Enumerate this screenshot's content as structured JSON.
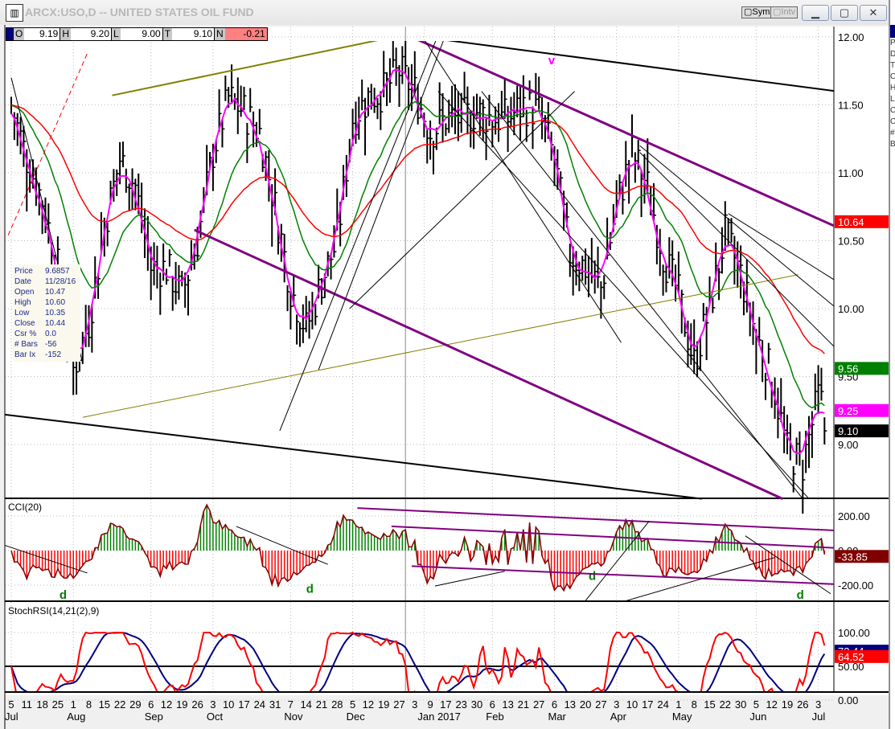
{
  "window": {
    "title": "ARCX:USO,D -- UNITED STATES OIL FUND",
    "app_icon": "chart-icon",
    "toolbar": {
      "sym_label": "Sym",
      "intv_label": "Intv"
    },
    "controls": {
      "minimize": "▁",
      "maximize": "▢",
      "close": "✕"
    }
  },
  "quote_bar": {
    "open_label": "O",
    "open": "9.19",
    "high_label": "H",
    "high": "9.20",
    "low_label": "L",
    "low": "9.00",
    "last_label": "T",
    "last": "9.10",
    "net_label": "N",
    "net": "-0.21"
  },
  "cursor_info": [
    {
      "k": "Price",
      "v": "9.6857"
    },
    {
      "k": "Date",
      "v": "11/28/16"
    },
    {
      "k": "Open",
      "v": "10.47"
    },
    {
      "k": "High",
      "v": "10.60"
    },
    {
      "k": "Low",
      "v": "10.35"
    },
    {
      "k": "Close",
      "v": "10.44"
    },
    {
      "k": "Csr %",
      "v": "0.0"
    },
    {
      "k": "# Bars",
      "v": "-56"
    },
    {
      "k": "Bar Ix",
      "v": "-152"
    }
  ],
  "right_panel_letters": [
    "P",
    "D",
    "T",
    "C",
    "H",
    "L",
    "C",
    "C",
    "#",
    "B"
  ],
  "colors": {
    "up": "#008000",
    "down": "#ff0000",
    "ma_fast": "#ff00ff",
    "ma_mid": "#008000",
    "ma_slow": "#ff0000",
    "purple": "#800080",
    "olive": "#808000",
    "stoch": "#ff0000",
    "stoch_signal": "#000080",
    "cci_line": "#800000"
  },
  "chart_data": {
    "type": "ohlc",
    "price_axis": {
      "ticks": [
        "12.00",
        "11.50",
        "11.00",
        "10.50",
        "10.00",
        "9.50",
        "9.00"
      ],
      "range": [
        8.6,
        12.1
      ]
    },
    "weekly_close_approx": [
      11.5,
      11.1,
      10.8,
      10.3,
      9.55,
      9.9,
      10.6,
      11.1,
      10.9,
      10.3,
      10.3,
      10.1,
      10.5,
      11.15,
      11.55,
      11.45,
      11.3,
      10.75,
      10.15,
      9.85,
      10.2,
      10.5,
      11.4,
      11.55,
      11.6,
      11.75,
      11.6,
      11.3,
      11.4,
      11.4,
      11.45,
      11.4,
      11.4,
      11.5,
      11.45,
      11.1,
      10.4,
      10.3,
      10.15,
      10.75,
      11.15,
      10.9,
      10.4,
      10.1,
      9.6,
      10.0,
      10.55,
      10.25,
      9.8,
      9.5,
      8.95,
      8.85,
      9.35,
      9.1
    ],
    "price_tags": [
      {
        "label": "10.64",
        "value": 10.64,
        "color": "#ff0000"
      },
      {
        "label": "9.56",
        "value": 9.56,
        "color": "#008000"
      },
      {
        "label": "9.25",
        "value": 9.25,
        "color": "#ff00ff"
      },
      {
        "label": "9.10",
        "value": 9.1,
        "color": "#000000"
      }
    ],
    "annotations": [
      {
        "text": "v",
        "week": 34.6,
        "price": 11.8,
        "color": "#ff00ff",
        "pane": "price"
      },
      {
        "text": "d",
        "week": 3.1,
        "cci": -280,
        "color": "#008000",
        "pane": "cci"
      },
      {
        "text": "d",
        "week": 19,
        "cci": -245,
        "color": "#008000",
        "pane": "cci"
      },
      {
        "text": "d",
        "week": 37.2,
        "cci": -170,
        "color": "#008000",
        "pane": "cci"
      },
      {
        "text": "d",
        "week": 50.6,
        "cci": -280,
        "color": "#008000",
        "pane": "cci"
      }
    ],
    "trendlines": [
      {
        "from": [
          19.8,
          12.1
        ],
        "to": [
          53.2,
          11.6
        ],
        "color": "#000000",
        "width": 2
      },
      {
        "from": [
          -0.4,
          9.22
        ],
        "to": [
          44.5,
          8.6
        ],
        "color": "#000000",
        "width": 2
      },
      {
        "from": [
          6.5,
          11.57
        ],
        "to": [
          28,
          12.08
        ],
        "color": "#808000",
        "width": 2
      },
      {
        "from": [
          4.6,
          9.2
        ],
        "to": [
          50.7,
          10.25
        ],
        "color": "#808000",
        "width": 1
      },
      {
        "from": [
          25.8,
          12.0
        ],
        "to": [
          53.2,
          10.6
        ],
        "color": "#800080",
        "width": 3
      },
      {
        "from": [
          11.8,
          10.58
        ],
        "to": [
          49.7,
          8.6
        ],
        "color": "#800080",
        "width": 3
      },
      {
        "from": [
          -0.2,
          10.54
        ],
        "to": [
          4.9,
          11.88
        ],
        "color": "#ff0000",
        "width": 1,
        "dash": true
      },
      {
        "from": [
          0,
          11.7
        ],
        "to": [
          4.6,
          9.6
        ],
        "color": "#000000",
        "width": 1
      },
      {
        "from": [
          17.3,
          9.1
        ],
        "to": [
          27.8,
          12.1
        ],
        "color": "#000000",
        "width": 1
      },
      {
        "from": [
          19.8,
          9.55
        ],
        "to": [
          28.2,
          12.08
        ],
        "color": "#000000",
        "width": 1
      },
      {
        "from": [
          21.8,
          10.0
        ],
        "to": [
          36.3,
          11.6
        ],
        "color": "#000000",
        "width": 1
      },
      {
        "from": [
          26.5,
          12.0
        ],
        "to": [
          39.3,
          9.75
        ],
        "color": "#000000",
        "width": 1
      },
      {
        "from": [
          27.5,
          11.6
        ],
        "to": [
          51.4,
          8.6
        ],
        "color": "#000000",
        "width": 1
      },
      {
        "from": [
          30.3,
          11.6
        ],
        "to": [
          51,
          8.6
        ],
        "color": "#000000",
        "width": 1
      },
      {
        "from": [
          40.5,
          11.2
        ],
        "to": [
          53.2,
          10.0
        ],
        "color": "#000000",
        "width": 1
      },
      {
        "from": [
          40.5,
          11.15
        ],
        "to": [
          53.2,
          9.7
        ],
        "color": "#000000",
        "width": 1
      },
      {
        "from": [
          46.2,
          10.7
        ],
        "to": [
          53.2,
          10.2
        ],
        "color": "#000000",
        "width": 1
      }
    ],
    "cci": {
      "title": "CCI(20)",
      "ticks": [
        "200.00",
        "0.00",
        "-200.00"
      ],
      "last_label": "-33.85",
      "trendlines": [
        {
          "from": [
            22.3,
            246
          ],
          "to": [
            53.2,
            116
          ],
          "color": "#800080",
          "width": 2
        },
        {
          "from": [
            24.5,
            140
          ],
          "to": [
            53.2,
            15
          ],
          "color": "#800080",
          "width": 2
        },
        {
          "from": [
            25.8,
            -90
          ],
          "to": [
            53.2,
            -195
          ],
          "color": "#800080",
          "width": 2
        },
        {
          "from": [
            27.3,
            -205
          ],
          "to": [
            31.8,
            -120
          ],
          "color": "#000000",
          "width": 1
        },
        {
          "from": [
            36.2,
            -380
          ],
          "to": [
            41.1,
            170
          ],
          "color": "#000000",
          "width": 1
        },
        {
          "from": [
            36.2,
            -380
          ],
          "to": [
            49.2,
            -40
          ],
          "color": "#000000",
          "width": 1
        },
        {
          "from": [
            -0.4,
            30
          ],
          "to": [
            4.9,
            -130
          ],
          "color": "#000000",
          "width": 1
        },
        {
          "from": [
            14.5,
            140
          ],
          "to": [
            20.4,
            -80
          ],
          "color": "#000000",
          "width": 1
        },
        {
          "from": [
            47.3,
            85
          ],
          "to": [
            52.8,
            -250
          ],
          "color": "#000000",
          "width": 1
        }
      ]
    },
    "stochrsi": {
      "title": "StochRSI(14,21(2),9)",
      "ticks": [
        "100.00",
        "50.00",
        "0.00"
      ],
      "blue_label": "72.44",
      "red_label": "64.52",
      "level": 50
    },
    "date_axis": {
      "days": [
        "5",
        "11",
        "18",
        "25",
        "1",
        "8",
        "15",
        "22",
        "29",
        "6",
        "12",
        "19",
        "26",
        "3",
        "10",
        "17",
        "24",
        "31",
        "7",
        "14",
        "21",
        "28",
        "5",
        "12",
        "19",
        "27",
        "3",
        "9",
        "17",
        "23",
        "30",
        "6",
        "13",
        "21",
        "27",
        "6",
        "13",
        "20",
        "27",
        "3",
        "10",
        "17",
        "24",
        "1",
        "8",
        "15",
        "22",
        "30",
        "5",
        "12",
        "19",
        "26",
        "3"
      ],
      "months": [
        {
          "label": "Jul",
          "week": 0
        },
        {
          "label": "Aug",
          "week": 4
        },
        {
          "label": "Sep",
          "week": 9
        },
        {
          "label": "Oct",
          "week": 13
        },
        {
          "label": "Nov",
          "week": 18
        },
        {
          "label": "Dec",
          "week": 22
        },
        {
          "label": "Jan 2017",
          "week": 26.6
        },
        {
          "label": "Feb",
          "week": 31
        },
        {
          "label": "Mar",
          "week": 35
        },
        {
          "label": "Apr",
          "week": 39
        },
        {
          "label": "May",
          "week": 43
        },
        {
          "label": "Jun",
          "week": 48
        },
        {
          "label": "Jul",
          "week": 52
        }
      ]
    }
  }
}
